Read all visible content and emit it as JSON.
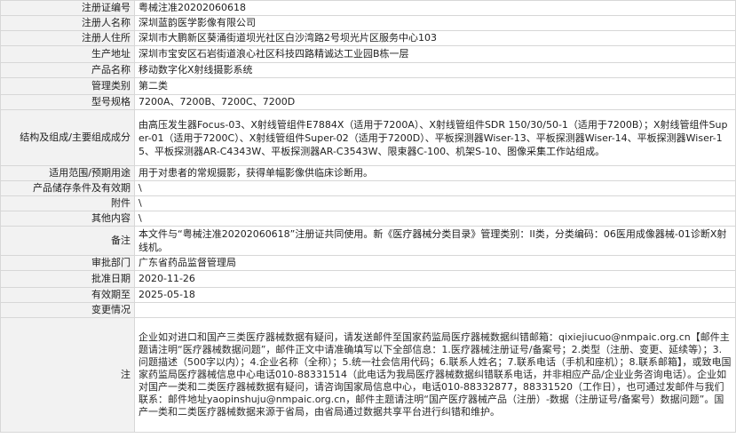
{
  "rows": [
    {
      "label": "注册证编号",
      "value": "粤械注准20202060618"
    },
    {
      "label": "注册人名称",
      "value": "深圳蓝韵医学影像有限公司"
    },
    {
      "label": "注册人住所",
      "value": "深圳市大鹏新区葵涌街道坝光社区白沙湾路2号坝光片区服务中心103"
    },
    {
      "label": "生产地址",
      "value": "深圳市宝安区石岩街道浪心社区科技四路精诚达工业园B栋一层"
    },
    {
      "label": "产品名称",
      "value": "移动数字化X射线摄影系统"
    },
    {
      "label": "管理类别",
      "value": "第二类"
    },
    {
      "label": "型号规格",
      "value": "7200A、7200B、7200C、7200D"
    },
    {
      "label": "结构及组成/主要组成成分",
      "value": "由高压发生器Focus-03、X射线管组件E7884X（适用于7200A）、X射线管组件SDR 150/30/50-1（适用于7200B）；X射线管组件Super-01（适用于7200C）、X射线管组件Super-02（适用于7200D）、平板探测器Wiser-13、平板探测器Wiser-14、平板探测器Wiser-15、平板探测器AR-C4343W、平板探测器AR-C3543W、限束器C-100、机架S-10、图像采集工作站组成。"
    },
    {
      "label": "适用范围/预期用途",
      "value": "用于对患者的常规摄影，获得单幅影像供临床诊断用。"
    },
    {
      "label": "产品储存条件及有效期",
      "value": "\\"
    },
    {
      "label": "附件",
      "value": "\\"
    },
    {
      "label": "其他内容",
      "value": "\\"
    },
    {
      "label": "备注",
      "value": "本文件与“粤械注准20202060618”注册证共同使用。新《医疗器械分类目录》管理类别：II类，分类编码：06医用成像器械-01诊断X射线机。"
    },
    {
      "label": "审批部门",
      "value": "广东省药品监督管理局"
    },
    {
      "label": "批准日期",
      "value": "2020-11-26"
    },
    {
      "label": "有效期至",
      "value": "2025-05-18"
    },
    {
      "label": "变更情况",
      "value": ""
    },
    {
      "label": "注",
      "value": "企业如对进口和国产三类医疗器械数据有疑问，请发送邮件至国家药监局医疗器械数据纠错邮箱：qixiejiucuo@nmpaic.org.cn【邮件主题请注明“医疗器械数据问题”，邮件正文中请准确填写以下全部信息：1.医疗器械注册证号/备案号；2.类型（注册、变更、延续等）；3.问题描述（500字以内）；4.企业名称（全称）；5.统一社会信用代码；6.联系人姓名；7.联系电话（手机和座机）；8.联系邮箱】，或致电国家药监局医疗器械信息中心电话010-88331514（此电话为我局医疗器械数据纠错联系电话，并非相应产品/企业业务咨询电话）。企业如对国产一类和二类医疗器械数据有疑问，请咨询国家局信息中心，电话010-88332877，88331520（工作日），也可通过发邮件与我们联系：邮件地址yaopinshuju@nmpaic.org.cn，邮件主题请注明“国产医疗器械产品（注册）-数据（注册证号/备案号）数据问题”。国产一类和二类医疗器械数据来源于省局，由省局通过数据共享平台进行纠错和维护。"
    }
  ]
}
